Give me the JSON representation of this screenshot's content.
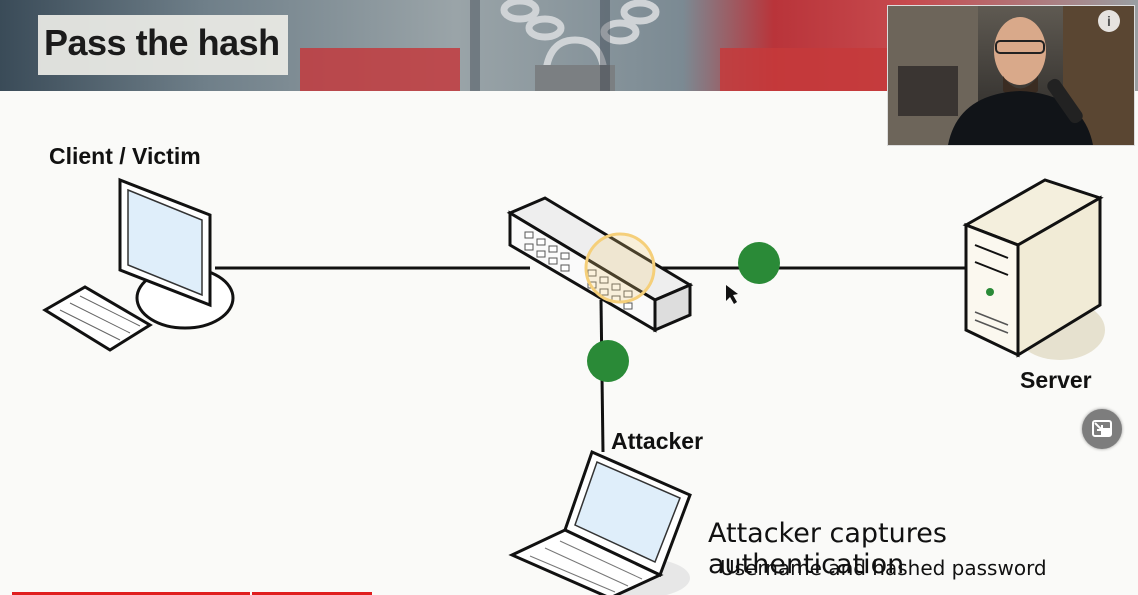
{
  "slide": {
    "title": "Pass the hash",
    "labels": {
      "client": "Client / Victim",
      "server": "Server",
      "attacker": "Attacker"
    },
    "caption": "Attacker captures authentication",
    "subcaption": "Username and hashed password"
  },
  "player": {
    "info_icon": "info-icon",
    "pip_icon": "picture-in-picture-icon",
    "progress": 0.32
  },
  "colors": {
    "packet": "#2a8a37",
    "highlight": "#f5cf7a",
    "progress": "#e01e1e"
  }
}
